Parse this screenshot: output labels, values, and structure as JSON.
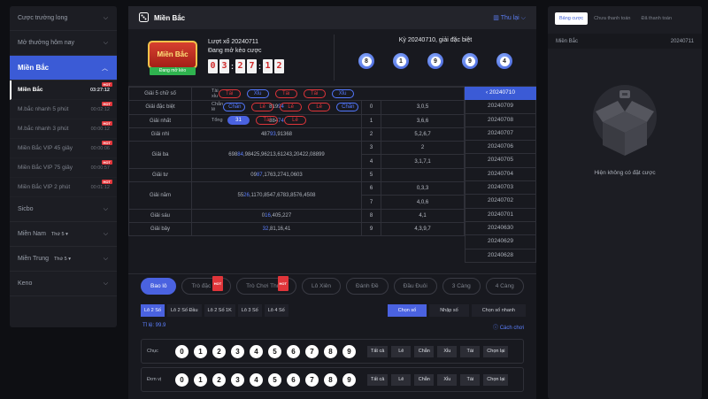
{
  "sidebar": {
    "items_top": [
      {
        "label": "Cược trường long"
      },
      {
        "label": "Mở thưởng hôm nay"
      }
    ],
    "active": {
      "label": "Miền Bắc"
    },
    "subitems": [
      {
        "label": "Miền Bắc",
        "time": "03:27:12",
        "hot": "HOT"
      },
      {
        "label": "M.bắc nhanh 5 phút",
        "time": "00:02:12",
        "hot": "HOT"
      },
      {
        "label": "M.bắc nhanh 3 phút",
        "time": "00:00:12",
        "hot": "HOT"
      },
      {
        "label": "Miền Bắc VIP 45 giây",
        "time": "00:00:06",
        "hot": "HOT"
      },
      {
        "label": "Miền Bắc VIP 75 giây",
        "time": "00:00:57",
        "hot": "HOT"
      },
      {
        "label": "Miền Bắc VIP 2 phút",
        "time": "00:01:12",
        "hot": "HOT"
      }
    ],
    "items_bottom": [
      {
        "label": "Sicbo",
        "extra": ""
      },
      {
        "label": "Miền Nam",
        "extra": "Thứ 5 ▾"
      },
      {
        "label": "Miền Trung",
        "extra": "Thứ 5 ▾"
      },
      {
        "label": "Keno",
        "extra": ""
      }
    ]
  },
  "main": {
    "title": "Miền Bắc",
    "collapse": "Thu lại",
    "logo_text": "Miền Bắc",
    "logo_status": "Đang mở kèo",
    "turn_label": "Lượt xổ 20240711",
    "turn_status": "Đang mở kèo cược",
    "countdown": {
      "h1": "0",
      "h2": "3",
      "m1": "2",
      "m2": "7",
      "s1": "1",
      "s2": "2"
    },
    "special_caption": "Kỳ 20240710, giải đặc biệt",
    "special_balls": [
      "8",
      "1",
      "9",
      "9",
      "4"
    ]
  },
  "results": {
    "g5_label": "Giải 5 chữ số",
    "opt_rows": [
      {
        "label": "Tài xỉu",
        "pills": [
          "Tài",
          "Xỉu",
          "Tài",
          "Tài",
          "Xỉu"
        ]
      },
      {
        "label": "Chẵn lẻ",
        "pills": [
          "Chẵn",
          "Lẻ",
          "Lẻ",
          "Lẻ",
          "Chẵn"
        ]
      },
      {
        "label": "Tổng",
        "pills": [
          "31",
          "Tài",
          "Lẻ"
        ]
      }
    ],
    "prizes": [
      {
        "label": "Giải đặc biệt",
        "pre": "819",
        "hl": "94",
        "rest": ""
      },
      {
        "label": "Giải nhất",
        "pre": "884",
        "hl": "74",
        "rest": ""
      },
      {
        "label": "Giải nhì",
        "pre": "487",
        "hl": "93",
        "rest": ",91368"
      },
      {
        "label": "Giải ba",
        "pre": "698",
        "hl": "84",
        "rest": ",98425,96213,61243,20422,08899"
      },
      {
        "label": "Giải tư",
        "pre": "09",
        "hl": "87",
        "rest": ",1763,2741,0603"
      },
      {
        "label": "Giải năm",
        "pre": "55",
        "hl": "26",
        "rest": ",1170,8547,6783,8576,4508"
      },
      {
        "label": "Giải sáu",
        "pre": "0",
        "hl": "16",
        "rest": ",405,227"
      },
      {
        "label": "Giải bảy",
        "pre": "",
        "hl": "32",
        "rest": ",81,16,41"
      }
    ],
    "heads": [
      {
        "head": "0",
        "tail": "3,0,5"
      },
      {
        "head": "1",
        "tail": "3,6,6"
      },
      {
        "head": "2",
        "tail": "5,2,6,7"
      },
      {
        "head": "3",
        "tail": "2"
      },
      {
        "head": "4",
        "tail": "3,1,7,1"
      },
      {
        "head": "5",
        "tail": ""
      },
      {
        "head": "6",
        "tail": "0,3,3"
      },
      {
        "head": "7",
        "tail": "4,0,6"
      },
      {
        "head": "8",
        "tail": "4,1"
      },
      {
        "head": "9",
        "tail": "4,3,9,7"
      }
    ],
    "dates": [
      "20240710",
      "20240709",
      "20240708",
      "20240707",
      "20240706",
      "20240705",
      "20240704",
      "20240703",
      "20240702",
      "20240701",
      "20240630",
      "20240629",
      "20240628"
    ]
  },
  "game_tabs": [
    {
      "label": "Bao lô",
      "hot": ""
    },
    {
      "label": "Trò đặc sắc",
      "hot": "HOT"
    },
    {
      "label": "Trò Chơi Thú Vị",
      "hot": "HOT"
    },
    {
      "label": "Lô Xiên",
      "hot": ""
    },
    {
      "label": "Đánh Đề",
      "hot": ""
    },
    {
      "label": "Đầu Đuôi",
      "hot": ""
    },
    {
      "label": "3 Càng",
      "hot": ""
    },
    {
      "label": "4 Càng",
      "hot": ""
    }
  ],
  "sub_tabs": [
    "Lô 2 Số",
    "Lô 2 Số Đầu",
    "Lô 2 Số 1K",
    "Lô 3 Số",
    "Lô 4 Số"
  ],
  "modes": [
    "Chọn số",
    "Nhập số",
    "Chọn số nhanh"
  ],
  "rate": "Tỉ lệ: 99.9",
  "help": "Cách chơi",
  "pick_rows": [
    {
      "label": "Chục"
    },
    {
      "label": "Đơn vị"
    }
  ],
  "digits": [
    "0",
    "1",
    "2",
    "3",
    "4",
    "5",
    "6",
    "7",
    "8",
    "9"
  ],
  "quick": [
    "Tất cả",
    "Lẻ",
    "Chẵn",
    "Xỉu",
    "Tài",
    "Chọn lại"
  ],
  "right": {
    "tabs": [
      "Bảng cược",
      "Chưa thanh toán",
      "Đã thanh toán"
    ],
    "game": "Miền Bắc",
    "date": "20240711",
    "empty": "Hiện không có đặt cược"
  }
}
